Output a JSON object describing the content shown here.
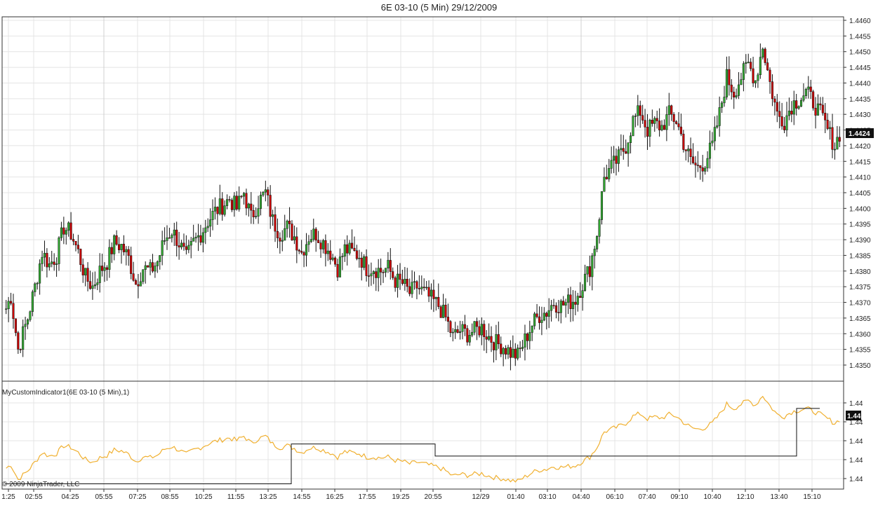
{
  "window": {
    "title": "6E 03-10 (5 Min)  29/12/2009",
    "copyright": "© 2009 NinjaTrader, LLC",
    "indicator_label": "MyCustomIndicator1(6E 03-10 (5 Min),1)"
  },
  "colors": {
    "up_candle": "#33aa33",
    "down_candle": "#cc0000",
    "wick": "#111111",
    "indicator_orange": "#f0b030",
    "indicator_black": "#111111",
    "grid": "#e4e4e4",
    "frame": "#333333",
    "last_price_bg": "#111111"
  },
  "price_panel": {
    "y_ticks": [
      "1.4460",
      "1.4455",
      "1.4450",
      "1.4445",
      "1.4440",
      "1.4435",
      "1.4430",
      "1.4425",
      "1.4420",
      "1.4415",
      "1.4410",
      "1.4405",
      "1.4400",
      "1.4395",
      "1.4390",
      "1.4385",
      "1.4380",
      "1.4375",
      "1.4370",
      "1.4365",
      "1.4360",
      "1.4355",
      "1.4350"
    ],
    "last_price_label": "1.4424"
  },
  "indicator_panel": {
    "y_ticks": [
      "1.44",
      "1.44",
      "1.44",
      "1.44",
      "1.44"
    ],
    "last_value_label": "1.44"
  },
  "chart_data": {
    "type": "candlestick",
    "title": "6E 03-10 (5 Min)  29/12/2009",
    "x_ticks": [
      "1:25",
      "02:55",
      "04:25",
      "05:55",
      "07:25",
      "08:55",
      "10:25",
      "11:55",
      "13:25",
      "14:55",
      "16:25",
      "17:55",
      "19:25",
      "20:55",
      "12/29",
      "01:40",
      "03:10",
      "04:40",
      "06:10",
      "07:40",
      "09:10",
      "10:40",
      "12:10",
      "13:40",
      "15:10"
    ],
    "ylim": [
      1.4347,
      1.4462
    ],
    "price_anchors": [
      [
        0,
        1.4368
      ],
      [
        2,
        1.4372
      ],
      [
        5,
        1.4355
      ],
      [
        9,
        1.4365
      ],
      [
        12,
        1.4375
      ],
      [
        15,
        1.4386
      ],
      [
        18,
        1.4382
      ],
      [
        21,
        1.4385
      ],
      [
        24,
        1.4394
      ],
      [
        27,
        1.4392
      ],
      [
        30,
        1.4386
      ],
      [
        33,
        1.4378
      ],
      [
        36,
        1.4375
      ],
      [
        39,
        1.438
      ],
      [
        42,
        1.4383
      ],
      [
        45,
        1.4389
      ],
      [
        48,
        1.4388
      ],
      [
        51,
        1.4384
      ],
      [
        54,
        1.4376
      ],
      [
        57,
        1.4381
      ],
      [
        60,
        1.438
      ],
      [
        63,
        1.4383
      ],
      [
        66,
        1.439
      ],
      [
        69,
        1.4393
      ],
      [
        72,
        1.4389
      ],
      [
        75,
        1.4384
      ],
      [
        78,
        1.4389
      ],
      [
        81,
        1.4392
      ],
      [
        84,
        1.4396
      ],
      [
        87,
        1.4399
      ],
      [
        90,
        1.4401
      ],
      [
        93,
        1.4403
      ],
      [
        96,
        1.44
      ],
      [
        99,
        1.4405
      ],
      [
        102,
        1.4397
      ],
      [
        105,
        1.4402
      ],
      [
        108,
        1.4405
      ],
      [
        111,
        1.4396
      ],
      [
        114,
        1.4392
      ],
      [
        117,
        1.4394
      ],
      [
        120,
        1.4391
      ],
      [
        123,
        1.4386
      ],
      [
        126,
        1.4391
      ],
      [
        129,
        1.4392
      ],
      [
        132,
        1.4389
      ],
      [
        135,
        1.4386
      ],
      [
        138,
        1.4381
      ],
      [
        141,
        1.4387
      ],
      [
        144,
        1.4386
      ],
      [
        147,
        1.4385
      ],
      [
        150,
        1.4381
      ],
      [
        153,
        1.4381
      ],
      [
        156,
        1.438
      ],
      [
        159,
        1.4381
      ],
      [
        162,
        1.4377
      ],
      [
        165,
        1.4376
      ],
      [
        168,
        1.4373
      ],
      [
        171,
        1.4375
      ],
      [
        174,
        1.4373
      ],
      [
        177,
        1.4371
      ],
      [
        180,
        1.4369
      ],
      [
        183,
        1.4365
      ],
      [
        186,
        1.4359
      ],
      [
        189,
        1.4361
      ],
      [
        192,
        1.436
      ],
      [
        195,
        1.4361
      ],
      [
        198,
        1.4362
      ],
      [
        201,
        1.4359
      ],
      [
        204,
        1.4357
      ],
      [
        207,
        1.4356
      ],
      [
        210,
        1.4354
      ],
      [
        213,
        1.4353
      ],
      [
        216,
        1.4358
      ],
      [
        219,
        1.4363
      ],
      [
        222,
        1.4366
      ],
      [
        225,
        1.4367
      ],
      [
        228,
        1.437
      ],
      [
        231,
        1.4369
      ],
      [
        234,
        1.437
      ],
      [
        237,
        1.4371
      ],
      [
        240,
        1.4376
      ],
      [
        243,
        1.4381
      ],
      [
        246,
        1.4392
      ],
      [
        249,
        1.441
      ],
      [
        252,
        1.4413
      ],
      [
        255,
        1.4416
      ],
      [
        258,
        1.442
      ],
      [
        261,
        1.4428
      ],
      [
        264,
        1.4431
      ],
      [
        267,
        1.4425
      ],
      [
        270,
        1.4427
      ],
      [
        273,
        1.4426
      ],
      [
        276,
        1.443
      ],
      [
        279,
        1.4428
      ],
      [
        282,
        1.4421
      ],
      [
        285,
        1.4415
      ],
      [
        288,
        1.4413
      ],
      [
        291,
        1.4415
      ],
      [
        294,
        1.442
      ],
      [
        297,
        1.443
      ],
      [
        300,
        1.4442
      ],
      [
        303,
        1.4437
      ],
      [
        306,
        1.4442
      ],
      [
        309,
        1.4446
      ],
      [
        312,
        1.4441
      ],
      [
        315,
        1.4452
      ],
      [
        318,
        1.444
      ],
      [
        321,
        1.443
      ],
      [
        324,
        1.4428
      ],
      [
        327,
        1.4433
      ],
      [
        330,
        1.4435
      ],
      [
        333,
        1.4437
      ],
      [
        336,
        1.4434
      ],
      [
        339,
        1.443
      ],
      [
        342,
        1.4425
      ],
      [
        345,
        1.442
      ],
      [
        347,
        1.4424
      ]
    ],
    "indicator": {
      "orange_series": "same as close prices",
      "black_steps": [
        [
          0,
          144,
          1.4351
        ],
        [
          144,
          231,
          1.4396
        ],
        [
          231,
          450,
          1.4381
        ],
        [
          450,
          555,
          1.4436
        ]
      ]
    },
    "grid": true
  }
}
